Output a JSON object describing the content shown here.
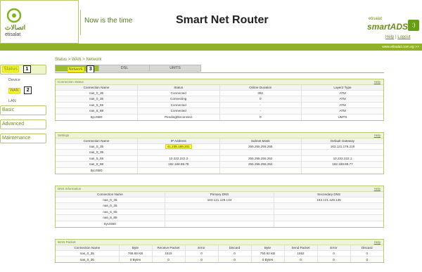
{
  "header": {
    "logo_arabic": "اتصالات",
    "logo_latin": "etisalat",
    "tagline": "Now is the time",
    "title": "Smart Net Router",
    "brand_small": "etisalat",
    "brand_big": "smartADSL",
    "help_label": "Help",
    "logout_label": "Logout",
    "url": "www.etisalat.com.eg >>"
  },
  "sidebar": {
    "status": "Status",
    "device": "Device",
    "wan": "WAN",
    "lan": "LAN",
    "basic": "Basic",
    "advanced": "Advanced",
    "maintenance": "Maintenance",
    "step1": "1",
    "step2": "2"
  },
  "breadcrumb": "Status > WAN > Network",
  "tabs": {
    "network": "Network",
    "dsl": "DSL",
    "umts": "UMTS",
    "step3": "3"
  },
  "connection_status": {
    "title": "Connection Status",
    "help": "Help",
    "headers": [
      "Connection Name",
      "Status",
      "Online Duration",
      "Layer2 Type"
    ],
    "rows": [
      [
        "nas_0_35",
        "Connected",
        "392",
        "ATM"
      ],
      [
        "nas_0_35",
        "Connecting",
        "0",
        "ATM"
      ],
      [
        "nas_5_55",
        "Connected",
        "-",
        "ATM"
      ],
      [
        "nas_8_88",
        "Connected",
        "-",
        "ATM"
      ],
      [
        "ttyUSB0",
        "PendingDisconnect",
        "0",
        "UMTS"
      ]
    ]
  },
  "settings": {
    "title": "Settings",
    "help": "Help",
    "headers": [
      "Connection Name",
      "IP Address",
      "Subnet Mask",
      "Default Gateway"
    ],
    "rows": [
      [
        "nas_0_35",
        "41.235.189.201",
        "255.255.255.255",
        "163.121.176.219"
      ],
      [
        "nas_0_35",
        "",
        "",
        ""
      ],
      [
        "nas_5_55",
        "10.222.222.2",
        "255.255.255.252",
        "10.222.222.1"
      ],
      [
        "nas_8_88",
        "192.168.88.78",
        "255.255.255.252",
        "192.168.88.77"
      ],
      [
        "ttyUSB0",
        "",
        "",
        ""
      ]
    ]
  },
  "dns": {
    "title": "DNS Information",
    "help": "Help",
    "headers": [
      "Connection Name",
      "Primary DNS",
      "Secondary DNS"
    ],
    "rows": [
      [
        "nas_0_35",
        "163.121.128.134",
        "163.121.128.135"
      ],
      [
        "nas_0_35",
        "",
        ""
      ],
      [
        "nas_5_55",
        "",
        ""
      ],
      [
        "nas_8_88",
        "",
        ""
      ],
      [
        "ttyUSB0",
        "",
        ""
      ]
    ]
  },
  "wan_packet": {
    "title": "WAN Packet",
    "help": "Help",
    "headers": [
      "Connection Name",
      "Byte",
      "Receive Packet",
      "Error",
      "Discard",
      "Byte",
      "Send Packet",
      "Error",
      "Discard"
    ],
    "rows": [
      [
        "nas_0_35",
        "768.69 KB",
        "1515",
        "0",
        "0",
        "750.92 KB",
        "1552",
        "0",
        "0"
      ],
      [
        "nas_0_35",
        "0 Bytes",
        "0",
        "0",
        "0",
        "0 Bytes",
        "0",
        "0",
        "0"
      ]
    ]
  }
}
